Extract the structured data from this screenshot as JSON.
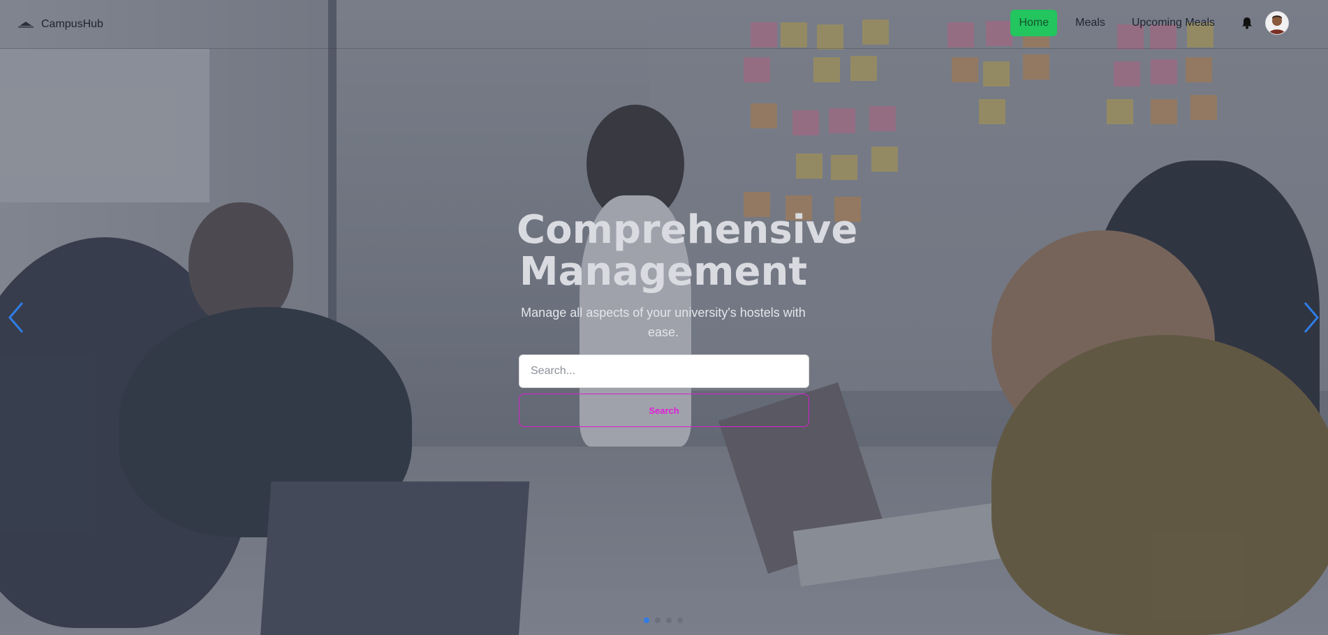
{
  "brand": {
    "name": "CampusHub",
    "logo_icon": "hat-logo-icon"
  },
  "nav": {
    "links": [
      {
        "label": "Home",
        "active": true
      },
      {
        "label": "Meals",
        "active": false
      },
      {
        "label": "Upcoming Meals",
        "active": false
      }
    ],
    "notification_icon": "bell-icon",
    "profile_icon": "avatar"
  },
  "hero": {
    "title_line1": "Comprehensive",
    "title_line2": "Management",
    "subtitle": "Manage all aspects of your university's hostels with ease.",
    "search_placeholder": "Search...",
    "search_button": "Search"
  },
  "carousel": {
    "prev_icon": "chevron-left-icon",
    "next_icon": "chevron-right-icon",
    "slide_count": 4,
    "active_slide": 1
  },
  "colors": {
    "active_nav": "#22c55e",
    "search_button_accent": "#e01ed7",
    "carousel_arrow": "#2f7de6"
  }
}
